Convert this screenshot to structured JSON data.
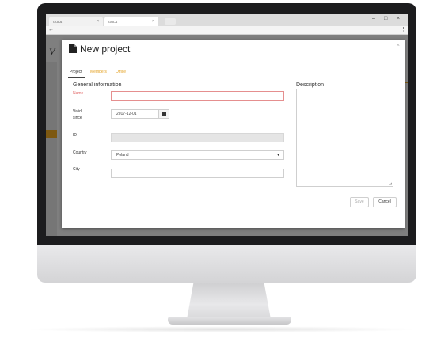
{
  "browser": {
    "tabs": [
      {
        "label": "GOLA"
      },
      {
        "label": "GOLA"
      }
    ],
    "tab_close": "×",
    "window_controls": {
      "min": "–",
      "max": "□",
      "close": "×"
    },
    "back": "←",
    "menu": "⋮"
  },
  "background_app": {
    "logo": "V"
  },
  "modal": {
    "title": "New project",
    "close": "×",
    "tabs": [
      {
        "label": "Project",
        "active": true
      },
      {
        "label": "Members",
        "active": false
      },
      {
        "label": "Office",
        "active": false
      }
    ],
    "general_title": "General information",
    "description_title": "Description",
    "fields": {
      "name": {
        "label": "Name",
        "value": ""
      },
      "valid_since": {
        "label_line1": "Valid",
        "label_line2": "since",
        "value": "2017-12-01"
      },
      "id": {
        "label": "ID",
        "value": ""
      },
      "country": {
        "label": "Country",
        "value": "Poland",
        "caret": "▼"
      },
      "city": {
        "label": "City",
        "value": ""
      }
    },
    "buttons": {
      "save": "Save",
      "cancel": "Cancel"
    }
  },
  "colors": {
    "accent": "#e3a020",
    "error": "#e26a6a"
  }
}
